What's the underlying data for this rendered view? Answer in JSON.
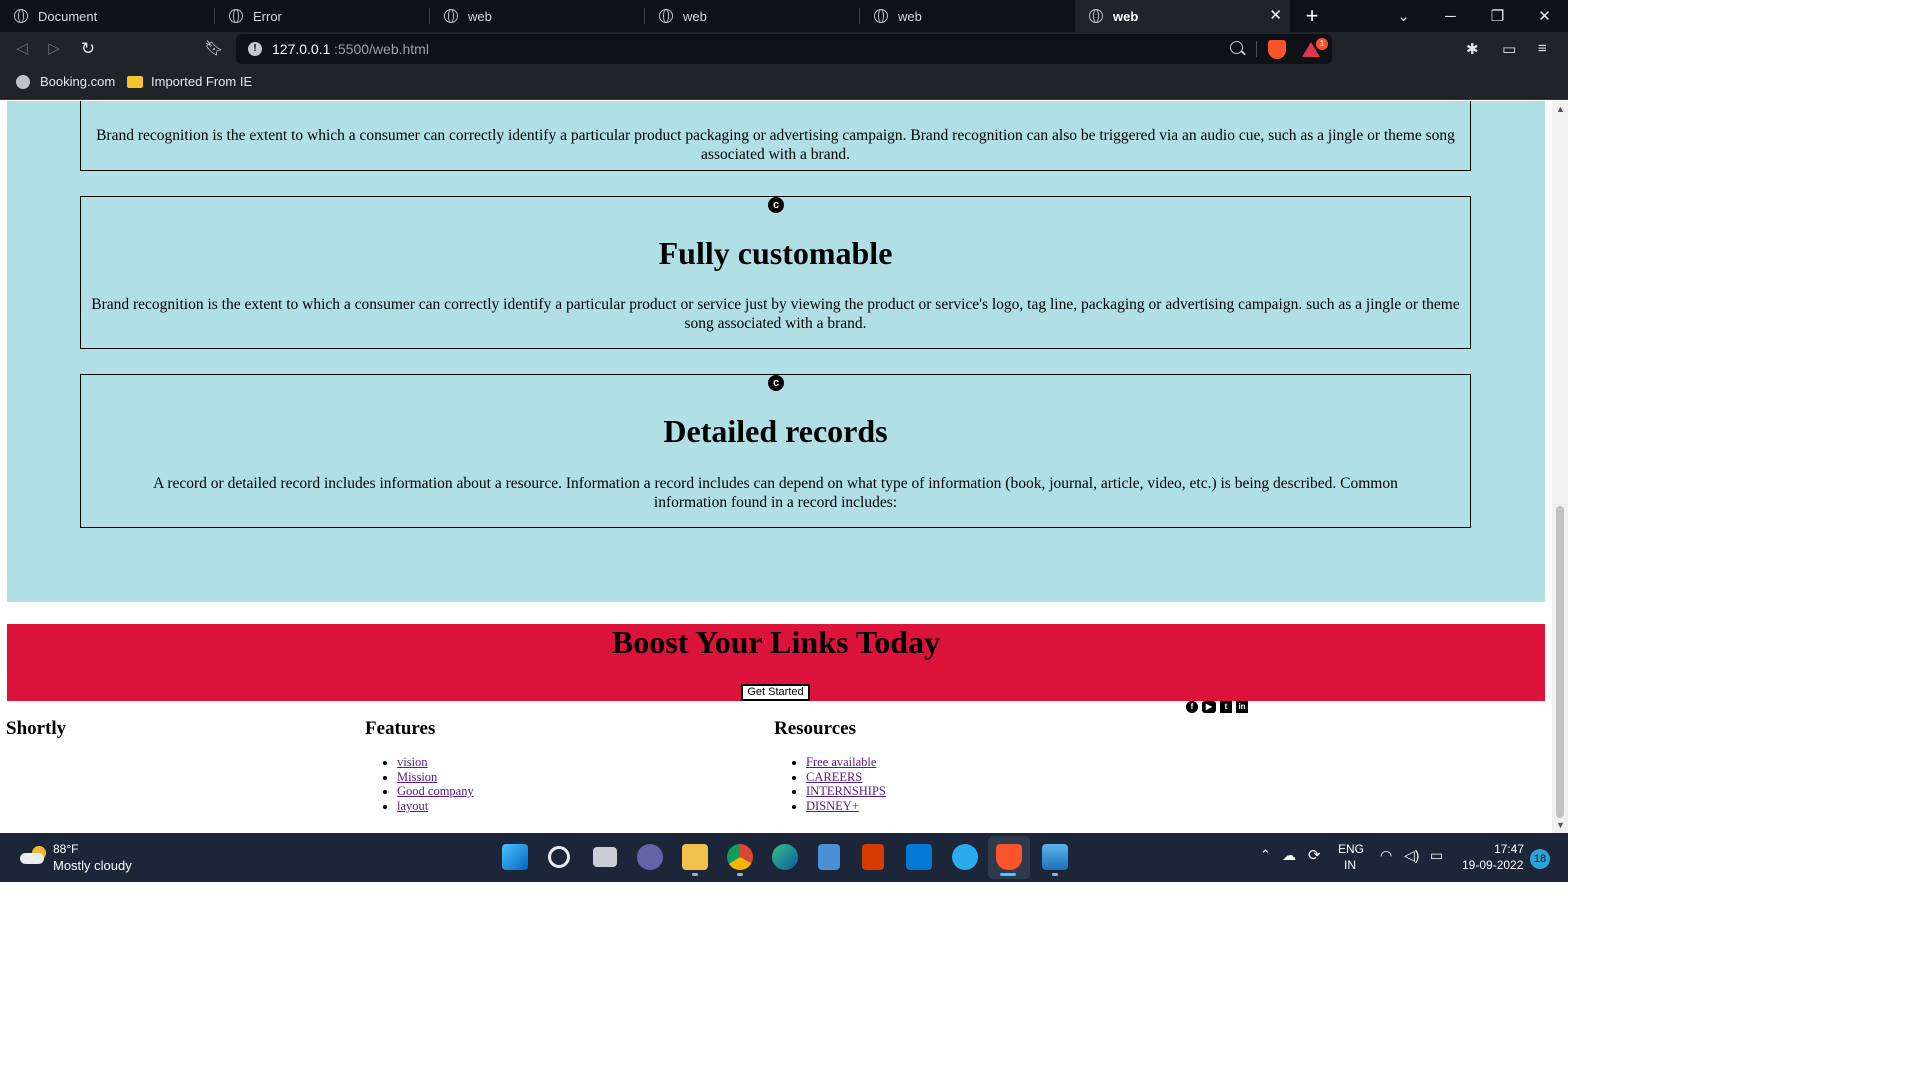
{
  "browser": {
    "tabs": [
      {
        "title": "Document",
        "active": false
      },
      {
        "title": "Error",
        "active": false
      },
      {
        "title": "web",
        "active": false
      },
      {
        "title": "web",
        "active": false
      },
      {
        "title": "web",
        "active": false
      },
      {
        "title": "web",
        "active": true
      }
    ],
    "new_tab_label": "+",
    "url_host": "127.0.0.1",
    "url_path": ":5500/web.html",
    "rewards_badge": "1",
    "bookmarks": [
      {
        "label": "Booking.com",
        "icon": "globe-icon"
      },
      {
        "label": "Imported From IE",
        "icon": "folder-icon"
      }
    ]
  },
  "page": {
    "cards": [
      {
        "icon": "c",
        "title": "",
        "text": "Brand recognition is the extent to which a consumer can correctly identify a particular product packaging or advertising campaign. Brand recognition can also be triggered via an audio cue, such as a jingle or theme song associated with a brand."
      },
      {
        "icon": "c",
        "title": "Fully customable",
        "text": "Brand recognition is the extent to which a consumer can correctly identify a particular product or service just by viewing the product or service's logo, tag line, packaging or advertising campaign. such as a jingle or theme song associated with a brand."
      },
      {
        "icon": "c",
        "title": "Detailed records",
        "text": "A record or detailed record includes information about a resource. Information a record includes can depend on what type of information (book, journal, article, video, etc.) is being described. Common information found in a record includes:"
      }
    ],
    "cta": {
      "title": "Boost Your Links Today",
      "button": "Get Started"
    },
    "social_icons": [
      "facebook-icon",
      "youtube-icon",
      "twitter-icon",
      "linkedin-icon"
    ],
    "footer": {
      "brand": "Shortly",
      "features": {
        "heading": "Features",
        "links": [
          "vision",
          "Mission",
          "Good company",
          "layout"
        ]
      },
      "resources": {
        "heading": "Resources",
        "links": [
          "Free available",
          "CAREERS",
          "INTERNSHIPS",
          "DISNEY+"
        ]
      }
    }
  },
  "colors": {
    "section_bg": "#b0e0e6",
    "cta_bg": "#dc143c",
    "link": "#551a8b"
  },
  "taskbar": {
    "weather_temp": "88°F",
    "weather_desc": "Mostly cloudy",
    "lang": "ENG",
    "region": "IN",
    "time": "17:47",
    "date": "19-09-2022",
    "notifications": "18"
  }
}
